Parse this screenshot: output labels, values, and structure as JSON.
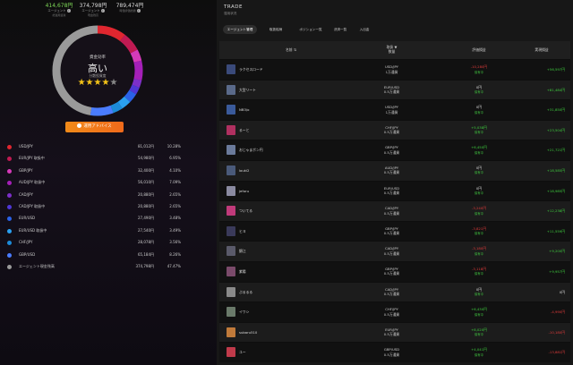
{
  "stats": [
    {
      "value": "414,678円",
      "label": "エージェント",
      "sub": "総運用資産",
      "color": "#7ed957"
    },
    {
      "value": "374,798円",
      "label": "エージェント",
      "sub": "現金残高",
      "color": "#dddddd"
    },
    {
      "value": "789,474円",
      "label": "",
      "sub": "時価評価総額",
      "color": "#dddddd"
    }
  ],
  "gauge": {
    "caption": "資金効率",
    "level": "高い",
    "stars_caption": "分散投資度",
    "stars_filled": 4,
    "stars_total": 5
  },
  "advice_button": "運用アドバイス",
  "donut_segments": [
    {
      "color": "#e0262f",
      "value": 10.28
    },
    {
      "color": "#c01a52",
      "value": 6.95
    },
    {
      "color": "#d63ab9",
      "value": 4.1
    },
    {
      "color": "#a51fb8",
      "value": 7.09
    },
    {
      "color": "#7d2fc9",
      "value": 2.65
    },
    {
      "color": "#4f37d6",
      "value": 2.65
    },
    {
      "color": "#2a62e8",
      "value": 3.48
    },
    {
      "color": "#2aa0f0",
      "value": 3.49
    },
    {
      "color": "#1c8bd8",
      "value": 3.56
    },
    {
      "color": "#4a7cff",
      "value": 8.26
    },
    {
      "color": "#9a9a9a",
      "value": 47.47
    }
  ],
  "pairs": [
    {
      "name": "USD/JPY",
      "amount": "81,012円",
      "pct": "10.28%",
      "color": "#e0262f"
    },
    {
      "name": "EUR/JPY 取扱中",
      "amount": "54,980円",
      "pct": "6.95%",
      "color": "#c01a52"
    },
    {
      "name": "GBP/JPY",
      "amount": "32,400円",
      "pct": "4.10%",
      "color": "#d63ab9"
    },
    {
      "name": "AUD/JPY 取扱中",
      "amount": "56,010円",
      "pct": "7.09%",
      "color": "#a51fb8"
    },
    {
      "name": "CAD/JPY",
      "amount": "20,880円",
      "pct": "2.65%",
      "color": "#7d2fc9"
    },
    {
      "name": "CAD/JPY 取扱中",
      "amount": "20,880円",
      "pct": "2.65%",
      "color": "#4f37d6"
    },
    {
      "name": "EUR/USD",
      "amount": "27,490円",
      "pct": "3.48%",
      "color": "#2a62e8"
    },
    {
      "name": "EUR/USD 取扱中",
      "amount": "27,540円",
      "pct": "3.49%",
      "color": "#2aa0f0"
    },
    {
      "name": "CHF/JPY",
      "amount": "28,078円",
      "pct": "3.56%",
      "color": "#1c8bd8"
    },
    {
      "name": "GBP/USD",
      "amount": "65,184円",
      "pct": "8.26%",
      "color": "#4a7cff"
    },
    {
      "name": "エージェント現金残高",
      "amount": "374,798円",
      "pct": "47.47%",
      "color": "#9a9a9a"
    }
  ],
  "trade": {
    "title": "TRADE",
    "subtitle": "運用状況",
    "tabs": [
      "エージェント管理",
      "取扱銘柄",
      "ポジション一覧",
      "決済一覧",
      "入出金"
    ],
    "headers": {
      "name": "名前",
      "pair1": "取扱",
      "pair2": "数量",
      "eval": "評価損益",
      "realized": "実現損益"
    },
    "rows": [
      {
        "name": "ラクセスロード",
        "pair": "USD/JPY",
        "qty": "1万通貨",
        "eval": "-10,280円",
        "status": "保有中",
        "realized": "+56,597円",
        "avatar": "#3a4a7a",
        "eval_sign": "neg",
        "real_sign": "pos"
      },
      {
        "name": "大型リート",
        "pair": "EUR/USD",
        "qty": "0.5万通貨",
        "eval": "0円",
        "status": "保有中",
        "realized": "+81,484円",
        "avatar": "#5a6a8a",
        "eval_sign": "zero",
        "real_sign": "pos"
      },
      {
        "name": "NB3/o",
        "pair": "USD/JPY",
        "qty": "1万通貨",
        "eval": "0円",
        "status": "保有中",
        "realized": "+31,850円",
        "avatar": "#3a5a9a",
        "eval_sign": "zero",
        "real_sign": "pos"
      },
      {
        "name": "るーと",
        "pair": "CHF/JPY",
        "qty": "0.5万通貨",
        "eval": "+5,038円",
        "status": "保有中",
        "realized": "+23,504円",
        "avatar": "#b03060",
        "eval_sign": "pos",
        "real_sign": "pos"
      },
      {
        "name": "おじゃまポン円",
        "pair": "GBP/JPY",
        "qty": "0.5万通貨",
        "eval": "+6,450円",
        "status": "保有中",
        "realized": "+21,721円",
        "avatar": "#6a7a9a",
        "eval_sign": "pos",
        "real_sign": "pos"
      },
      {
        "name": "louki2",
        "pair": "AUD/JPY",
        "qty": "0.5万通貨",
        "eval": "0円",
        "status": "保有中",
        "realized": "+18,585円",
        "avatar": "#4a5a7a",
        "eval_sign": "zero",
        "real_sign": "pos"
      },
      {
        "name": "jeforu",
        "pair": "EUR/USD",
        "qty": "0.5万通貨",
        "eval": "0円",
        "status": "保有中",
        "realized": "+18,985円",
        "avatar": "#8a8aa0",
        "eval_sign": "zero",
        "real_sign": "pos"
      },
      {
        "name": "ついてる",
        "pair": "CAD/JPY",
        "qty": "0.5万通貨",
        "eval": "-3,240円",
        "status": "保有中",
        "realized": "+12,238円",
        "avatar": "#c03a7a",
        "eval_sign": "neg",
        "real_sign": "pos"
      },
      {
        "name": "ヒヨ",
        "pair": "GBP/JPY",
        "qty": "0.5万通貨",
        "eval": "-3,821円",
        "status": "保有中",
        "realized": "+11,559円",
        "avatar": "#3a3a5a",
        "eval_sign": "neg",
        "real_sign": "pos"
      },
      {
        "name": "錦江",
        "pair": "CAD/JPY",
        "qty": "0.5万通貨",
        "eval": "-3,180円",
        "status": "保有中",
        "realized": "+9,200円",
        "avatar": "#5a5a6a",
        "eval_sign": "neg",
        "real_sign": "pos"
      },
      {
        "name": "紫陽",
        "pair": "GBP/JPY",
        "qty": "0.5万通貨",
        "eval": "-3,118円",
        "status": "保有中",
        "realized": "+9,957円",
        "avatar": "#7a4a6a",
        "eval_sign": "neg",
        "real_sign": "pos"
      },
      {
        "name": "ぷるるる",
        "pair": "CAD/JPY",
        "qty": "0.5万通貨",
        "eval": "0円",
        "status": "保有中",
        "realized": "0円",
        "avatar": "#8a8a8a",
        "eval_sign": "zero",
        "real_sign": "zero"
      },
      {
        "name": "イワシ",
        "pair": "CHF/JPY",
        "qty": "0.5万通貨",
        "eval": "+6,430円",
        "status": "保有中",
        "realized": "-4,990円",
        "avatar": "#6a7a6a",
        "eval_sign": "pos",
        "real_sign": "neg"
      },
      {
        "name": "subaru510",
        "pair": "EUR/JPY",
        "qty": "0.5万通貨",
        "eval": "+8,020円",
        "status": "保有中",
        "realized": "-10,180円",
        "avatar": "#c07a3a",
        "eval_sign": "pos",
        "real_sign": "neg"
      },
      {
        "name": "ユー",
        "pair": "GBP/USD",
        "qty": "0.5万通貨",
        "eval": "+4,041円",
        "status": "保有中",
        "realized": "-13,881円",
        "avatar": "#c03a4a",
        "eval_sign": "pos",
        "real_sign": "neg"
      }
    ]
  }
}
